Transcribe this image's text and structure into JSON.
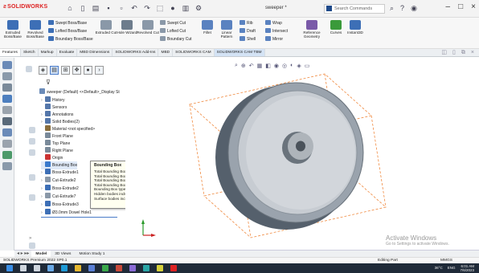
{
  "app": {
    "logo": "SOLIDWORKS",
    "window_title": "sweeper *"
  },
  "search": {
    "placeholder": "Search Commands"
  },
  "ribbon": {
    "big": [
      {
        "label": "Extruded Boss/Base",
        "color": "#3d6fb6"
      },
      {
        "label": "Revolved Boss/Base",
        "color": "#3d6fb6"
      },
      {
        "label": "Extruded Cut",
        "color": "#8a98a8"
      },
      {
        "label": "Hole Wizard",
        "color": "#6d7c8c"
      },
      {
        "label": "Revolved Cut",
        "color": "#8a98a8"
      },
      {
        "label": "Fillet",
        "color": "#5a82c0"
      },
      {
        "label": "Linear Pattern",
        "color": "#5a82c0"
      },
      {
        "label": "Reference Geometry",
        "color": "#7a5aa8"
      },
      {
        "label": "Curves",
        "color": "#3a9a3a"
      },
      {
        "label": "Instant3D",
        "color": "#3d6fb6"
      }
    ],
    "small": [
      {
        "label": "Swept Boss/Base",
        "color": "#3d6fb6"
      },
      {
        "label": "Lofted Boss/Base",
        "color": "#3d6fb6"
      },
      {
        "label": "Boundary Boss/Base",
        "color": "#3d6fb6"
      },
      {
        "label": "Swept Cut",
        "color": "#8a98a8"
      },
      {
        "label": "Lofted Cut",
        "color": "#8a98a8"
      },
      {
        "label": "Boundary Cut",
        "color": "#8a98a8"
      },
      {
        "label": "Rib",
        "color": "#5a82c0"
      },
      {
        "label": "Draft",
        "color": "#5a82c0"
      },
      {
        "label": "Shell",
        "color": "#5a82c0"
      },
      {
        "label": "Wrap",
        "color": "#5a82c0"
      },
      {
        "label": "Intersect",
        "color": "#5a82c0"
      },
      {
        "label": "Mirror",
        "color": "#5a82c0"
      }
    ]
  },
  "tabs": [
    "Features",
    "Sketch",
    "Markup",
    "Evaluate",
    "MBD Dimensions",
    "SOLIDWORKS Add-Ins",
    "MBD",
    "SOLIDWORKS CAM",
    "SOLIDWORKS CAM TBM"
  ],
  "tree": {
    "root": "sweeper (Default) <<Default>_Display St",
    "items": [
      {
        "label": "History",
        "color": "#5577aa"
      },
      {
        "label": "Sensors",
        "color": "#5577aa"
      },
      {
        "label": "Annotations",
        "color": "#5577aa"
      },
      {
        "label": "Solid Bodies(2)",
        "color": "#5577aa"
      },
      {
        "label": "Material <not specified>",
        "color": "#8a6d3b"
      },
      {
        "label": "Front Plane",
        "color": "#7a8a9a"
      },
      {
        "label": "Top Plane",
        "color": "#7a8a9a"
      },
      {
        "label": "Right Plane",
        "color": "#7a8a9a"
      },
      {
        "label": "Origin",
        "color": "#cc3333"
      },
      {
        "label": "Bounding Box",
        "color": "#3a7acc"
      },
      {
        "label": "Boss-Extrude1",
        "color": "#3d6fb6"
      },
      {
        "label": "Cut-Extrude2",
        "color": "#8a98a8"
      },
      {
        "label": "Boss-Extrude2",
        "color": "#3d6fb6"
      },
      {
        "label": "Cut-Extrude7",
        "color": "#8a98a8"
      },
      {
        "label": "Boss-Extrude3",
        "color": "#3d6fb6"
      },
      {
        "label": "Ø3.0mm Dowel Hole1",
        "color": "#3d6fb6"
      }
    ]
  },
  "tooltip": {
    "title": "Bounding Box",
    "lines": [
      "Total Bounding Box Length: 40mm",
      "Total Bounding Box Width: 40mm",
      "Total Bounding Box Thickness: 10mm",
      "Total Bounding Box Volume: 16000 mm^3",
      "Bounding Box type: Best Fit",
      "Hidden bodies included: No",
      "Surface bodies included: No"
    ]
  },
  "model_tabs": [
    "Model",
    "3D Views",
    "Motion Study 1"
  ],
  "status": {
    "left": "SOLIDWORKS Premium 2022 SP0.1",
    "mode": "Editing Part",
    "units": "MMGS"
  },
  "watermark": {
    "line1": "Activate Windows",
    "line2": "Go to Settings to activate Windows."
  },
  "tray": {
    "weather": "36°C",
    "lang": "ENG",
    "time": "6:01 AM",
    "date": "7/6/2023"
  }
}
